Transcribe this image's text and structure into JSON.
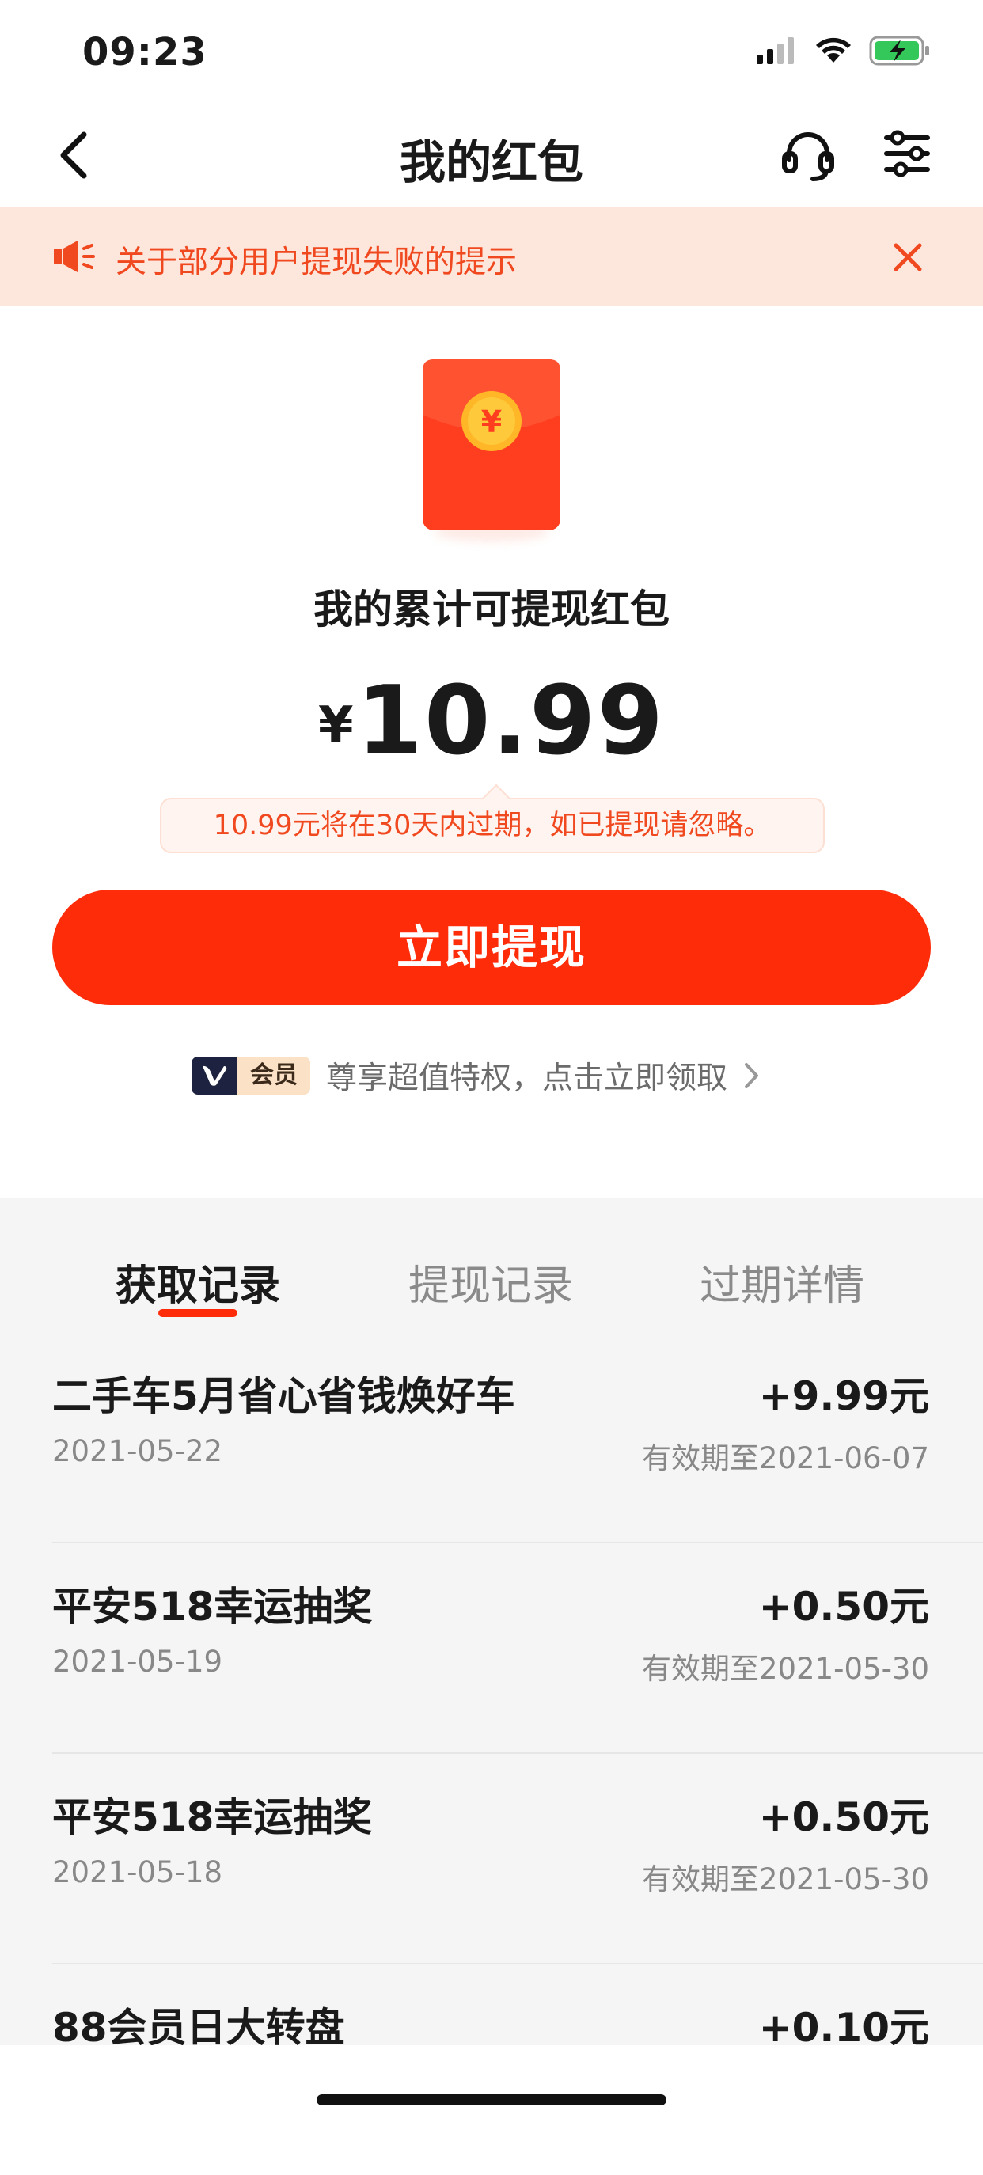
{
  "status_bar": {
    "time": "09:23"
  },
  "nav": {
    "title": "我的红包"
  },
  "notice": {
    "text": "关于部分用户提现失败的提示"
  },
  "summary": {
    "headline": "我的累计可提现红包",
    "currency": "¥",
    "amount": "10.99",
    "expire_tip": "10.99元将在30天内过期，如已提现请忽略。",
    "withdraw_label": "立即提现"
  },
  "vip": {
    "badge_label": "会员",
    "text": "尊享超值特权，点击立即领取"
  },
  "tabs": [
    {
      "label": "获取记录",
      "active": true
    },
    {
      "label": "提现记录",
      "active": false
    },
    {
      "label": "过期详情",
      "active": false
    }
  ],
  "records": [
    {
      "title": "二手车5月省心省钱焕好车",
      "date": "2021-05-22",
      "amount": "+9.99元",
      "valid": "有效期至2021-06-07"
    },
    {
      "title": "平安518幸运抽奖",
      "date": "2021-05-19",
      "amount": "+0.50元",
      "valid": "有效期至2021-05-30"
    },
    {
      "title": "平安518幸运抽奖",
      "date": "2021-05-18",
      "amount": "+0.50元",
      "valid": "有效期至2021-05-30"
    },
    {
      "title": "88会员日大转盘",
      "date": "",
      "amount": "+0.10元",
      "valid": ""
    }
  ],
  "colors": {
    "accent": "#ff2c0a",
    "notice_bg": "#fde7dd",
    "notice_text": "#f0481f",
    "list_bg": "#f5f5f5"
  }
}
